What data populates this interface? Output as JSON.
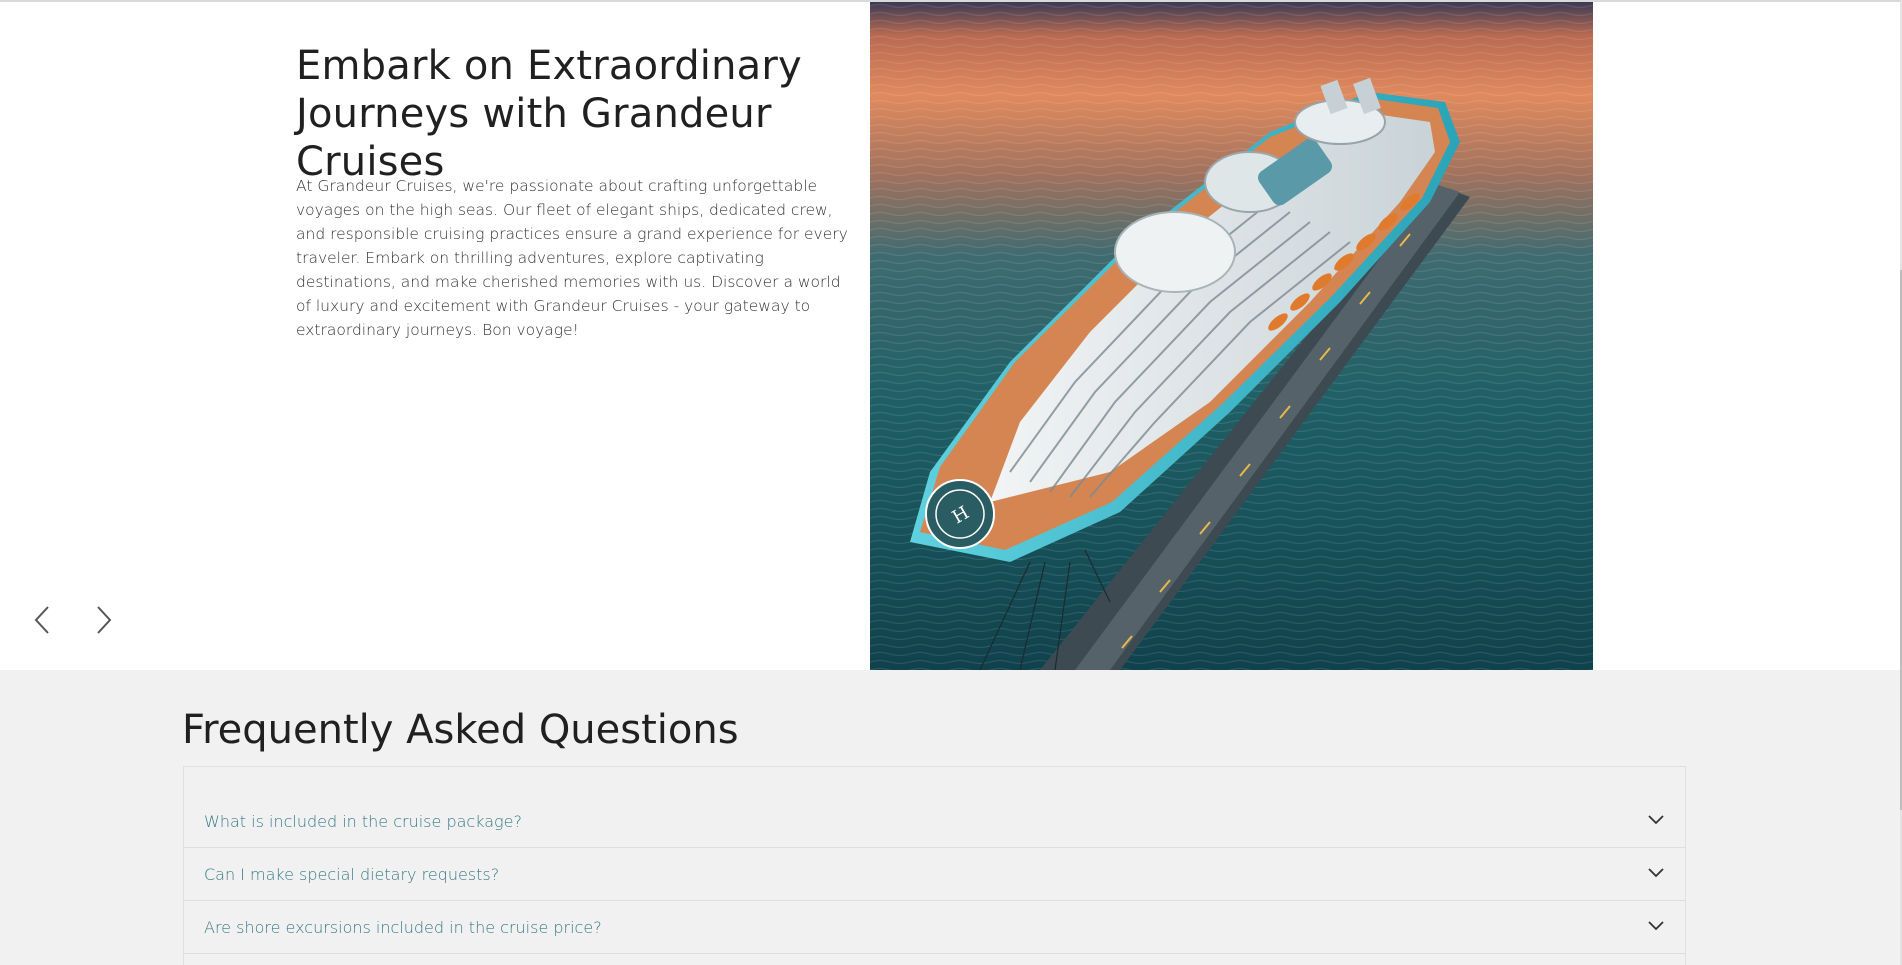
{
  "hero": {
    "title": "Embark on Extraordinary Journeys with Grandeur Cruises",
    "body": "At Grandeur Cruises, we're passionate about crafting unforgettable voyages on the high seas. Our fleet of elegant ships, dedicated crew, and responsible cruising practices ensure a grand experience for every traveler. Embark on thrilling adventures, explore captivating destinations, and make cherished memories with us. Discover a world of luxury and excitement with Grandeur Cruises - your gateway to extraordinary journeys. Bon voyage!",
    "image_subject": "aerial view of cruise ship docked at pier at sunset",
    "helipad_letter": "H",
    "prev_icon": "chevron-left-icon",
    "next_icon": "chevron-right-icon"
  },
  "faq": {
    "title": "Frequently Asked Questions",
    "items": [
      {
        "question": "What is included in the cruise package?",
        "expanded": false
      },
      {
        "question": "Can I make special dietary requests?",
        "expanded": false
      },
      {
        "question": "Are shore excursions included in the cruise price?",
        "expanded": false
      }
    ],
    "toggle_icon": "chevron-down-icon"
  },
  "colors": {
    "question_text": "#3a7a88",
    "faq_background": "#f1f1f1",
    "heading_text": "#202020"
  }
}
